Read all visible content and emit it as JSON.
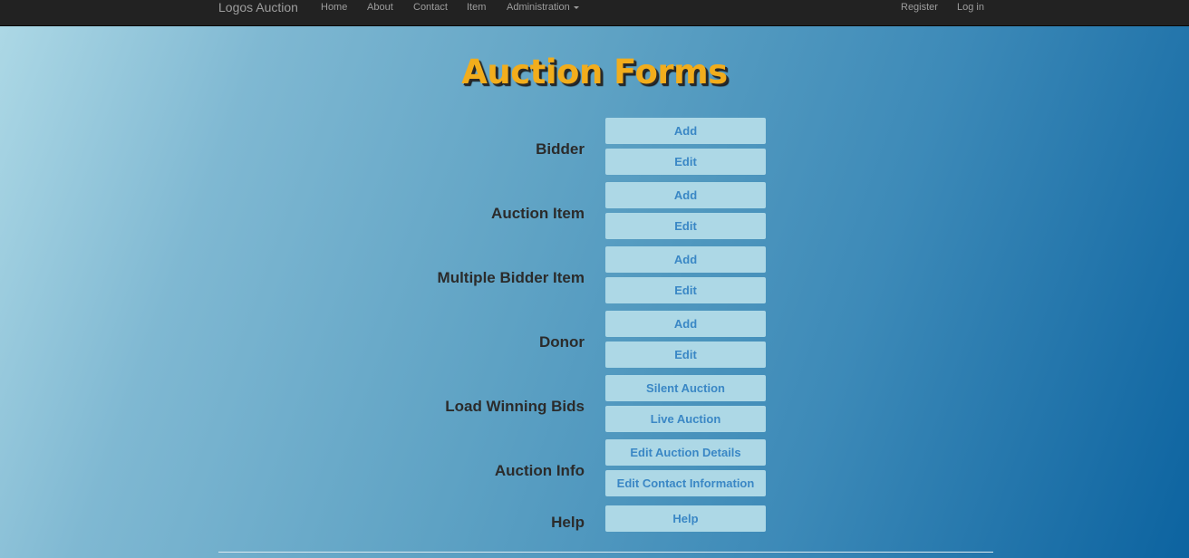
{
  "navbar": {
    "brand": "Logos Auction",
    "links": [
      "Home",
      "About",
      "Contact",
      "Item",
      "Administration"
    ],
    "right_links": [
      "Register",
      "Log in"
    ]
  },
  "page": {
    "title": "Auction Forms"
  },
  "sections": [
    {
      "label": "Bidder",
      "buttons": [
        "Add",
        "Edit"
      ]
    },
    {
      "label": "Auction Item",
      "buttons": [
        "Add",
        "Edit"
      ]
    },
    {
      "label": "Multiple Bidder Item",
      "buttons": [
        "Add",
        "Edit"
      ]
    },
    {
      "label": "Donor",
      "buttons": [
        "Add",
        "Edit"
      ]
    },
    {
      "label": "Load Winning Bids",
      "buttons": [
        "Silent Auction",
        "Live Auction"
      ]
    },
    {
      "label": "Auction Info",
      "buttons": [
        "Edit Auction Details",
        "Edit Contact Information"
      ]
    },
    {
      "label": "Help",
      "buttons": [
        "Help"
      ]
    }
  ],
  "colors": {
    "navbar_bg": "#222222",
    "title": "#f2ad1c",
    "button_bg": "#add8e6",
    "button_text": "#3a87c5"
  }
}
